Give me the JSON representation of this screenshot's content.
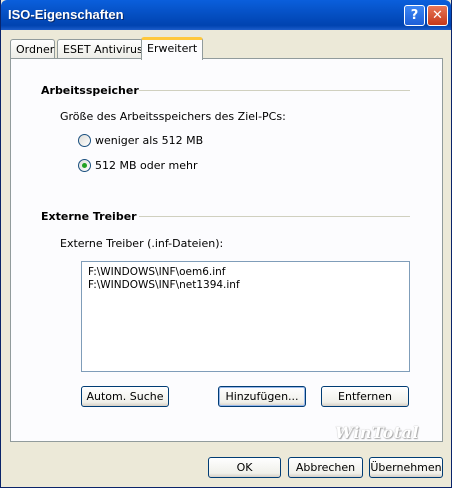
{
  "window": {
    "title": "ISO-Eigenschaften",
    "help_label": "?",
    "close_label": "✕"
  },
  "tabs": [
    {
      "label": "Ordner"
    },
    {
      "label": "ESET Antivirus"
    },
    {
      "label": "Erweitert"
    }
  ],
  "memory": {
    "title": "Arbeitsspeicher",
    "prompt": "Größe des Arbeitsspeichers des Ziel-PCs:",
    "options": [
      {
        "label": "weniger als 512 MB",
        "selected": false
      },
      {
        "label": "512 MB oder mehr",
        "selected": true
      }
    ]
  },
  "drivers": {
    "title": "Externe Treiber",
    "prompt": "Externe Treiber (.inf-Dateien):",
    "items": [
      "F:\\WINDOWS\\INF\\oem6.inf",
      "F:\\WINDOWS\\INF\\net1394.inf"
    ],
    "buttons": {
      "search": "Autom. Suche",
      "add": "Hinzufügen...",
      "remove": "Entfernen"
    }
  },
  "watermark": "WinTotal",
  "footer": {
    "ok": "OK",
    "cancel": "Abbrechen",
    "apply": "Übernehmen"
  }
}
